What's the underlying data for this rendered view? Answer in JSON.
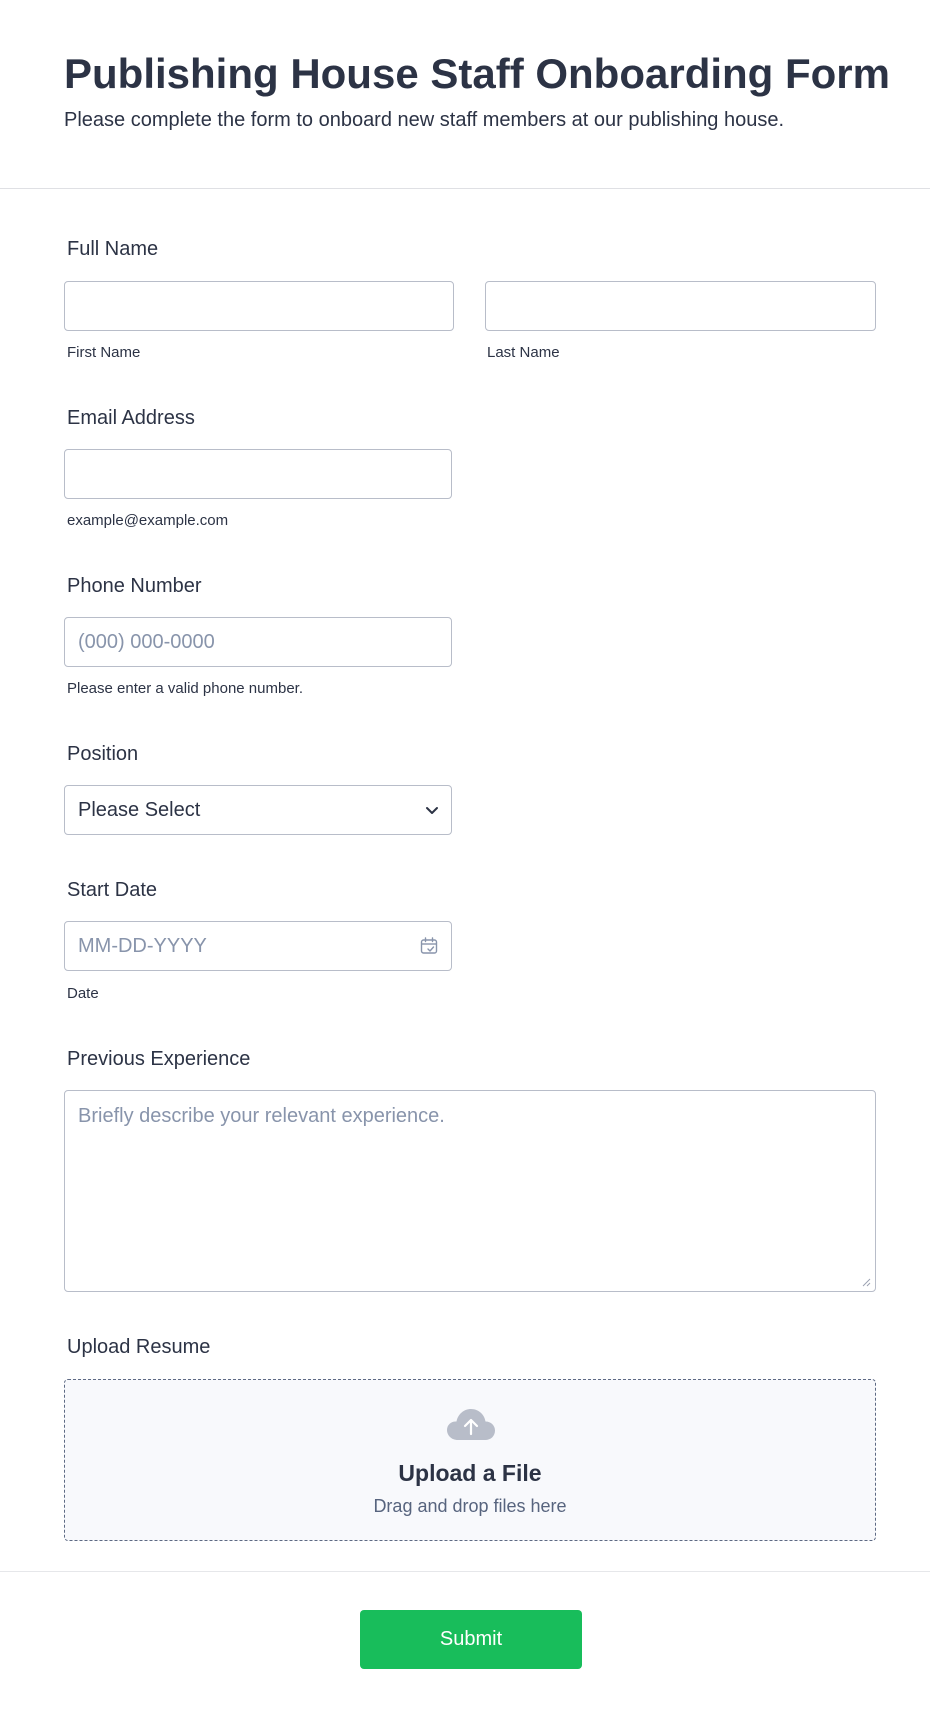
{
  "form": {
    "title": "Publishing House Staff Onboarding Form",
    "subtitle": "Please complete the form to onboard new staff members at our publishing house."
  },
  "full_name": {
    "label": "Full Name",
    "first_value": "",
    "last_value": "",
    "first_sublabel": "First Name",
    "last_sublabel": "Last Name"
  },
  "email": {
    "label": "Email Address",
    "value": "",
    "sublabel": "example@example.com"
  },
  "phone": {
    "label": "Phone Number",
    "placeholder": "(000) 000-0000",
    "sublabel": "Please enter a valid phone number."
  },
  "position": {
    "label": "Position",
    "selected": "Please Select"
  },
  "start_date": {
    "label": "Start Date",
    "placeholder": "MM-DD-YYYY",
    "sublabel": "Date"
  },
  "experience": {
    "label": "Previous Experience",
    "placeholder": "Briefly describe your relevant experience."
  },
  "resume": {
    "label": "Upload Resume",
    "title": "Upload a File",
    "subtitle": "Drag and drop files here"
  },
  "submit": {
    "label": "Submit"
  },
  "colors": {
    "text": "#2c3345",
    "placeholder": "#8894ab",
    "border": "#b8bdc9",
    "submit_bg": "#18bd5b",
    "upload_icon": "#b8bdc9"
  },
  "icons": {
    "select": "chevron-down-icon",
    "date": "calendar-icon",
    "upload": "cloud-upload-icon",
    "textarea": "resize-grip-icon"
  }
}
